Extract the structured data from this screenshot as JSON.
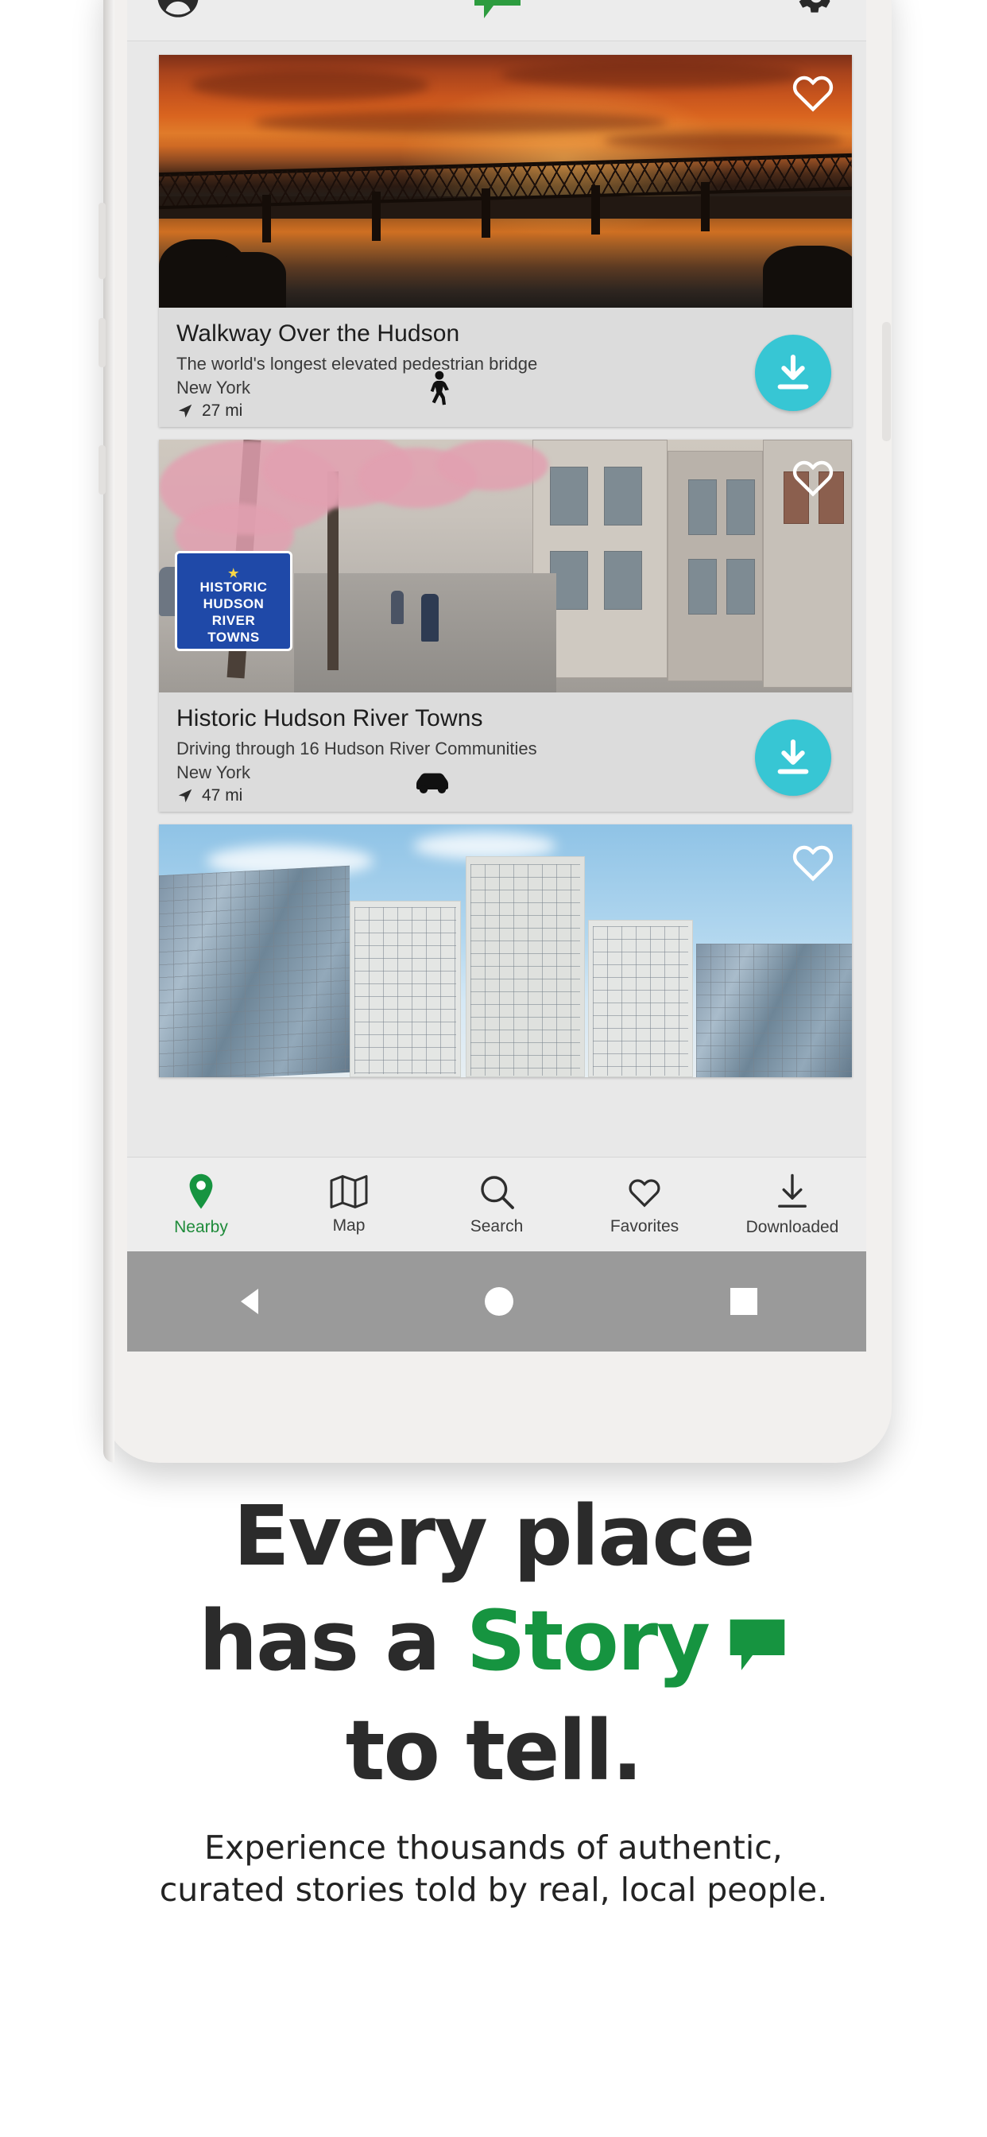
{
  "app": {
    "topbar": {
      "profile_icon": "account-circle-icon",
      "logo_icon": "speech-bubble-logo",
      "settings_icon": "gear-icon"
    },
    "cards": [
      {
        "title": "Walkway Over the Hudson",
        "subtitle": "The world's longest elevated pedestrian bridge",
        "region": "New York",
        "distance": "27 mi",
        "mode_icon": "walking-icon",
        "favorite_icon": "heart-outline-icon",
        "download_icon": "download-arrow-icon",
        "photo": "bridge-at-sunset"
      },
      {
        "title": "Historic Hudson River Towns",
        "subtitle": "Driving through 16 Hudson River Communities",
        "region": "New York",
        "distance": "47 mi",
        "mode_icon": "car-icon",
        "favorite_icon": "heart-outline-icon",
        "download_icon": "download-arrow-icon",
        "photo": "blossom-street",
        "sign": {
          "star": "★",
          "line1": "HISTORIC",
          "line2": "HUDSON",
          "line3": "RIVER",
          "line4": "TOWNS"
        }
      },
      {
        "title": "",
        "subtitle": "",
        "region": "",
        "distance": "",
        "mode_icon": "",
        "favorite_icon": "heart-outline-icon",
        "download_icon": "",
        "photo": "modern-glass-buildings"
      }
    ],
    "bottom_nav": [
      {
        "label": "Nearby",
        "icon": "map-pin-icon",
        "active": true
      },
      {
        "label": "Map",
        "icon": "map-icon",
        "active": false
      },
      {
        "label": "Search",
        "icon": "magnifier-icon",
        "active": false
      },
      {
        "label": "Favorites",
        "icon": "heart-outline-icon",
        "active": false
      },
      {
        "label": "Downloaded",
        "icon": "download-arrow-icon",
        "active": false
      }
    ],
    "system_bar": {
      "back": "triangle-back-icon",
      "home": "circle-home-icon",
      "recents": "square-recents-icon"
    }
  },
  "marketing": {
    "headline_line1": "Every place",
    "headline_line2_a": "has a ",
    "headline_line2_story": "Story",
    "headline_line3": "to tell.",
    "bubble_icon": "speech-bubble-icon",
    "subhead_line1": "Experience thousands of authentic,",
    "subhead_line2": "curated stories told by real, local people."
  },
  "colors": {
    "accent_green": "#169440",
    "download_cyan": "#37c6d4",
    "text_dark": "#2b2b2b"
  }
}
